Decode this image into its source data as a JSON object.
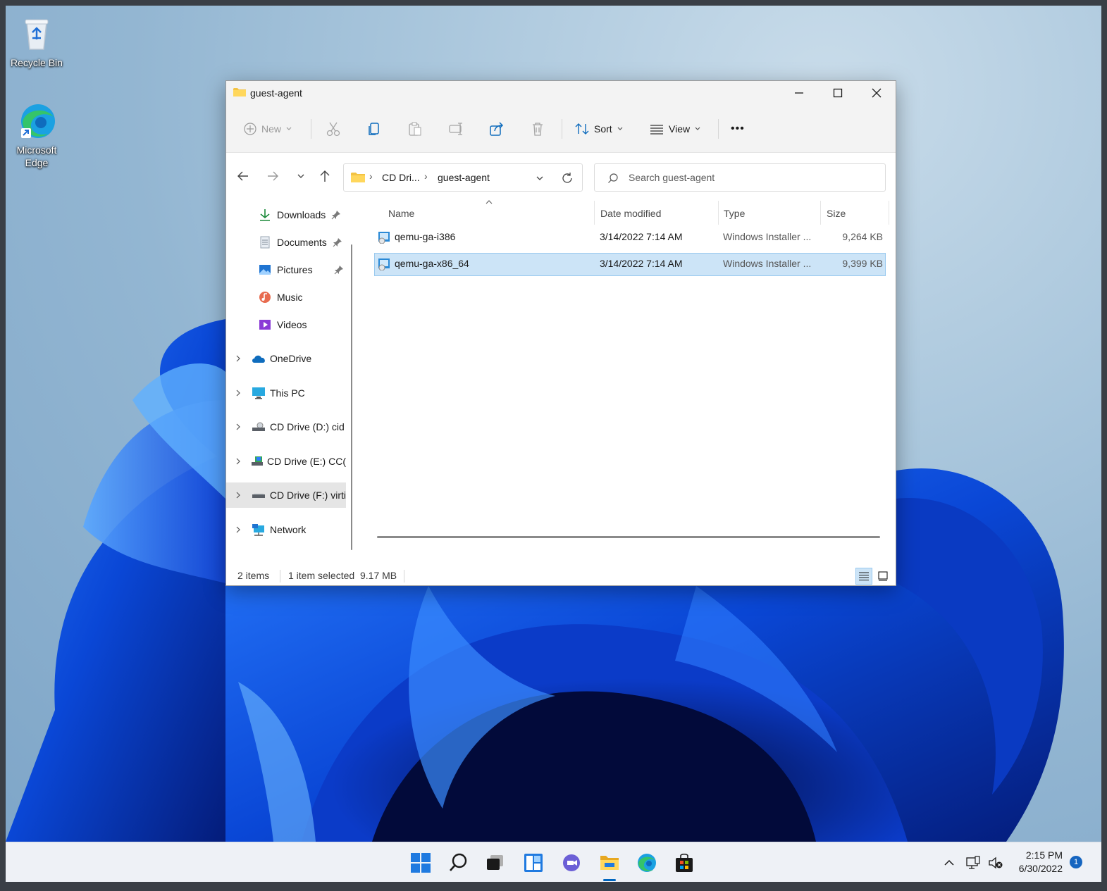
{
  "desktop": {
    "icons": [
      {
        "label": "Recycle Bin",
        "icon": "recycle-bin-icon"
      },
      {
        "label": "Microsoft Edge",
        "icon": "edge-icon"
      }
    ]
  },
  "window": {
    "title": "guest-agent",
    "controls": {
      "minimize": "minimize-icon",
      "maximize": "maximize-icon",
      "close": "close-icon"
    }
  },
  "command_bar": {
    "new_label": "New",
    "sort_label": "Sort",
    "view_label": "View",
    "more_label": "•••",
    "icons": [
      "cut-icon",
      "copy-icon",
      "paste-icon",
      "rename-icon",
      "share-icon",
      "delete-icon"
    ]
  },
  "address_bar": {
    "breadcrumb": [
      "CD Dri...",
      "guest-agent"
    ],
    "separator": "›"
  },
  "search": {
    "placeholder": "Search guest-agent"
  },
  "sidebar": {
    "quick_access": [
      {
        "label": "Downloads",
        "icon": "downloads-icon",
        "pinned": true
      },
      {
        "label": "Documents",
        "icon": "documents-icon",
        "pinned": true
      },
      {
        "label": "Pictures",
        "icon": "pictures-icon",
        "pinned": true
      },
      {
        "label": "Music",
        "icon": "music-icon",
        "pinned": false
      },
      {
        "label": "Videos",
        "icon": "videos-icon",
        "pinned": false
      }
    ],
    "locations": [
      {
        "label": "OneDrive",
        "icon": "onedrive-icon"
      },
      {
        "label": "This PC",
        "icon": "this-pc-icon"
      },
      {
        "label": "CD Drive (D:) cid",
        "icon": "cd-drive-icon"
      },
      {
        "label": "CD Drive (E:) CC(",
        "icon": "cd-drive-icon"
      },
      {
        "label": "CD Drive (F:) virti",
        "icon": "cd-drive-icon",
        "selected": true
      },
      {
        "label": "Network",
        "icon": "network-icon"
      }
    ]
  },
  "file_list": {
    "columns": [
      "Name",
      "Date modified",
      "Type",
      "Size"
    ],
    "rows": [
      {
        "name": "qemu-ga-i386",
        "date": "3/14/2022 7:14 AM",
        "type": "Windows Installer ...",
        "size": "9,264 KB",
        "selected": false
      },
      {
        "name": "qemu-ga-x86_64",
        "date": "3/14/2022 7:14 AM",
        "type": "Windows Installer ...",
        "size": "9,399 KB",
        "selected": true
      }
    ]
  },
  "status_bar": {
    "item_count": "2 items",
    "selection": "1 item selected",
    "selection_size": "9.17 MB"
  },
  "taskbar": {
    "icons": [
      "start-icon",
      "search-icon",
      "task-view-icon",
      "widgets-icon",
      "chat-icon",
      "file-explorer-icon",
      "edge-icon",
      "store-icon"
    ],
    "time": "2:15 PM",
    "date": "6/30/2022",
    "notification_count": "1"
  },
  "colors": {
    "accent": "#0067c0",
    "selection_bg": "#cce4f7",
    "selection_border": "#99c9ef",
    "taskbar_bg": "#eef1f6"
  }
}
